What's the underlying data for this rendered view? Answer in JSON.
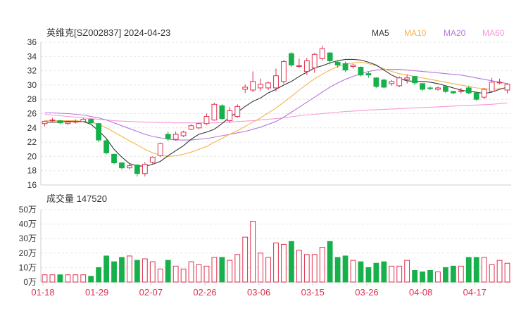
{
  "chart_data": [
    {
      "type": "candlestick",
      "title": "英维克[SZ002837] 2024-04-23",
      "legend": [
        {
          "name": "MA5",
          "color": "#333333"
        },
        {
          "name": "MA10",
          "color": "#f5b54b"
        },
        {
          "name": "MA20",
          "color": "#b57ad9"
        },
        {
          "name": "MA60",
          "color": "#f59ad6"
        }
      ],
      "ylim": [
        16,
        36
      ],
      "yticks": [
        16,
        18,
        20,
        22,
        24,
        26,
        28,
        30,
        32,
        34,
        36
      ],
      "grid": true,
      "up_color": "#e0304e",
      "down_color": "#17b04a",
      "candles": [
        [
          24.6,
          24.9,
          24.2,
          25.0
        ],
        [
          25.0,
          25.1,
          24.8,
          25.4
        ],
        [
          25.0,
          24.7,
          24.5,
          25.1
        ],
        [
          24.6,
          24.8,
          24.4,
          25.0
        ],
        [
          24.8,
          24.9,
          24.6,
          25.2
        ],
        [
          24.9,
          25.2,
          24.8,
          25.4
        ],
        [
          25.2,
          24.7,
          24.5,
          25.3
        ],
        [
          24.6,
          22.3,
          22.0,
          24.7
        ],
        [
          22.2,
          20.5,
          20.3,
          22.4
        ],
        [
          20.3,
          19.1,
          18.9,
          20.4
        ],
        [
          19.1,
          18.4,
          18.2,
          19.2
        ],
        [
          18.4,
          18.7,
          18.2,
          19.0
        ],
        [
          18.8,
          17.6,
          17.2,
          18.9
        ],
        [
          17.6,
          18.9,
          17.2,
          19.2
        ],
        [
          19.2,
          19.9,
          18.9,
          20.0
        ],
        [
          20.1,
          21.8,
          19.9,
          21.9
        ],
        [
          23.1,
          22.5,
          22.2,
          23.5
        ],
        [
          22.4,
          23.1,
          22.2,
          23.5
        ],
        [
          22.9,
          23.4,
          22.7,
          23.6
        ],
        [
          23.8,
          24.3,
          23.7,
          24.5
        ],
        [
          24.0,
          24.6,
          23.8,
          24.7
        ],
        [
          24.6,
          25.6,
          24.4,
          26.0
        ],
        [
          25.1,
          27.3,
          25.0,
          27.5
        ],
        [
          27.1,
          25.3,
          25.1,
          27.3
        ],
        [
          25.0,
          26.4,
          24.7,
          26.9
        ],
        [
          25.6,
          27.0,
          25.4,
          27.3
        ],
        [
          29.4,
          29.7,
          28.9,
          30.1
        ],
        [
          29.3,
          30.5,
          29.0,
          31.9
        ],
        [
          29.6,
          30.1,
          29.2,
          30.9
        ],
        [
          29.6,
          30.3,
          29.3,
          30.5
        ],
        [
          29.6,
          31.3,
          29.1,
          32.3
        ],
        [
          30.5,
          33.3,
          30.2,
          33.5
        ],
        [
          34.4,
          32.8,
          32.5,
          34.6
        ],
        [
          32.6,
          32.7,
          32.4,
          33.7
        ],
        [
          31.9,
          33.4,
          31.4,
          33.8
        ],
        [
          32.4,
          34.3,
          31.7,
          34.5
        ],
        [
          33.7,
          35.1,
          33.4,
          35.5
        ],
        [
          34.5,
          33.4,
          32.9,
          34.6
        ],
        [
          33.2,
          32.8,
          32.4,
          33.5
        ],
        [
          33.0,
          32.1,
          31.8,
          33.3
        ],
        [
          32.6,
          32.8,
          32.3,
          33.0
        ],
        [
          32.5,
          31.4,
          31.2,
          32.6
        ],
        [
          31.6,
          31.4,
          31.0,
          31.9
        ],
        [
          31.0,
          29.8,
          29.6,
          31.1
        ],
        [
          30.7,
          29.7,
          29.6,
          30.9
        ],
        [
          30.2,
          30.5,
          29.9,
          30.7
        ],
        [
          29.9,
          31.0,
          29.7,
          31.2
        ],
        [
          30.8,
          31.0,
          30.2,
          31.5
        ],
        [
          31.2,
          30.3,
          30.0,
          31.3
        ],
        [
          30.2,
          29.4,
          29.2,
          30.3
        ],
        [
          29.6,
          29.5,
          29.3,
          29.8
        ],
        [
          29.4,
          29.6,
          29.2,
          29.8
        ],
        [
          29.8,
          29.1,
          28.9,
          30.0
        ],
        [
          29.1,
          28.9,
          28.7,
          29.2
        ],
        [
          29.1,
          29.2,
          28.8,
          29.6
        ],
        [
          29.6,
          28.9,
          28.7,
          29.9
        ],
        [
          28.9,
          28.0,
          27.8,
          29.0
        ],
        [
          28.3,
          29.4,
          28.0,
          29.6
        ],
        [
          29.1,
          30.4,
          29.0,
          31.0
        ],
        [
          30.3,
          30.4,
          30.1,
          30.9
        ],
        [
          29.3,
          30.1,
          28.8,
          30.3
        ]
      ],
      "ma5": [
        24.8,
        24.8,
        24.85,
        24.9,
        24.9,
        24.9,
        24.5,
        23.6,
        22.5,
        21.0,
        19.9,
        19.0,
        18.7,
        18.6,
        18.9,
        19.3,
        20.1,
        20.8,
        21.5,
        22.4,
        23.1,
        23.4,
        23.8,
        24.6,
        25.5,
        26.2,
        27.0,
        27.7,
        28.2,
        28.9,
        29.4,
        30.0,
        30.5,
        31.2,
        31.8,
        32.4,
        32.7,
        33.1,
        33.4,
        33.6,
        33.6,
        33.5,
        33.2,
        32.8,
        32.1,
        31.4,
        30.9,
        30.6,
        30.5,
        30.5,
        30.4,
        30.2,
        29.9,
        29.6,
        29.3,
        29.1,
        29.0,
        28.8,
        29.0,
        29.4,
        29.7
      ],
      "ma10": [
        25.0,
        25.0,
        25.0,
        25.0,
        25.0,
        24.9,
        24.8,
        24.5,
        24.0,
        23.4,
        22.8,
        22.2,
        21.6,
        21.0,
        20.5,
        20.2,
        20.0,
        20.1,
        20.3,
        20.6,
        21.0,
        21.4,
        22.0,
        22.5,
        23.1,
        23.6,
        24.2,
        24.8,
        25.4,
        26.1,
        26.8,
        27.6,
        28.4,
        29.3,
        30.1,
        30.9,
        31.5,
        32.1,
        32.6,
        32.9,
        33.1,
        33.2,
        33.0,
        32.7,
        32.3,
        31.9,
        31.6,
        31.4,
        31.2,
        31.0,
        30.8,
        30.6,
        30.4,
        30.2,
        30.0,
        29.8,
        29.6,
        29.5,
        29.4,
        29.5,
        29.6
      ],
      "ma20": [
        26.1,
        26.1,
        26.05,
        26.0,
        25.9,
        25.8,
        25.6,
        25.4,
        25.1,
        24.7,
        24.3,
        23.9,
        23.5,
        23.1,
        22.8,
        22.6,
        22.4,
        22.3,
        22.3,
        22.3,
        22.4,
        22.5,
        22.7,
        22.9,
        23.1,
        23.3,
        23.5,
        23.8,
        24.1,
        24.5,
        24.9,
        25.5,
        26.2,
        26.9,
        27.6,
        28.3,
        29.0,
        29.7,
        30.3,
        30.8,
        31.2,
        31.6,
        31.9,
        32.1,
        32.2,
        32.2,
        32.2,
        32.1,
        32.0,
        31.9,
        31.8,
        31.7,
        31.6,
        31.5,
        31.4,
        31.2,
        31.0,
        30.8,
        30.6,
        30.4,
        30.2
      ],
      "ma60": [
        25.9,
        25.8,
        25.7,
        25.6,
        25.5,
        25.4,
        25.3,
        25.2,
        25.1,
        25.0,
        24.95,
        24.9,
        24.85,
        24.8,
        24.8,
        24.75,
        24.75,
        24.7,
        24.7,
        24.7,
        24.7,
        24.7,
        24.7,
        24.75,
        24.8,
        24.9,
        24.95,
        25.0,
        25.1,
        25.2,
        25.3,
        25.4,
        25.55,
        25.7,
        25.8,
        25.9,
        26.0,
        26.1,
        26.2,
        26.3,
        26.35,
        26.4,
        26.5,
        26.55,
        26.6,
        26.65,
        26.7,
        26.75,
        26.8,
        26.85,
        26.9,
        26.95,
        27.0,
        27.05,
        27.1,
        27.15,
        27.2,
        27.25,
        27.3,
        27.4,
        27.5
      ]
    },
    {
      "type": "bar",
      "title": "成交量 147520",
      "yunit": "万",
      "ylim": [
        0,
        50
      ],
      "yticks": [
        0,
        10,
        20,
        30,
        40,
        50
      ],
      "ytick_labels": [
        "0万",
        "10万",
        "20万",
        "30万",
        "40万",
        "50万"
      ],
      "x_tick_labels": [
        {
          "index": 0,
          "label": "01-18"
        },
        {
          "index": 7,
          "label": "01-29"
        },
        {
          "index": 14,
          "label": "02-07"
        },
        {
          "index": 21,
          "label": "02-26"
        },
        {
          "index": 28,
          "label": "03-06"
        },
        {
          "index": 35,
          "label": "03-15"
        },
        {
          "index": 42,
          "label": "03-26"
        },
        {
          "index": 49,
          "label": "04-08"
        },
        {
          "index": 56,
          "label": "04-17"
        }
      ],
      "values": [
        5,
        5,
        5,
        5,
        5,
        5,
        4,
        10,
        18,
        14,
        17,
        18,
        15,
        16,
        14,
        9,
        15,
        11,
        9,
        14,
        12,
        11,
        17,
        17,
        15,
        19,
        31,
        42,
        20,
        17,
        27,
        26,
        28,
        22,
        19,
        19,
        24,
        28,
        17,
        18,
        15,
        14,
        10,
        13,
        14,
        11,
        11,
        15,
        8,
        7,
        8,
        7,
        10,
        11,
        11,
        17,
        17,
        17,
        12,
        15,
        13
      ]
    }
  ]
}
